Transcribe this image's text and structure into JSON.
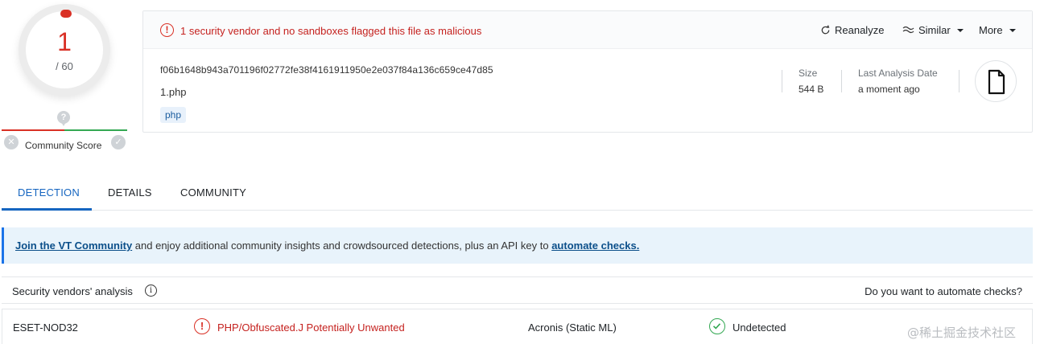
{
  "score": {
    "detections": "1",
    "total": "/ 60"
  },
  "community": {
    "label": "Community Score",
    "pin_glyph": "?"
  },
  "summary": {
    "alert": "1 security vendor and no sandboxes flagged this file as malicious",
    "actions": {
      "reanalyze": "Reanalyze",
      "similar": "Similar",
      "more": "More"
    },
    "hash": "f06b1648b943a701196f02772fe38f4161911950e2e037f84a136c659ce47d85",
    "filename": "1.php",
    "tag": "php",
    "size_label": "Size",
    "size_value": "544 B",
    "date_label": "Last Analysis Date",
    "date_value": "a moment ago"
  },
  "tabs": {
    "detection": "DETECTION",
    "details": "DETAILS",
    "community": "COMMUNITY",
    "active": "DETECTION"
  },
  "banner": {
    "link1": "Join the VT Community",
    "text": " and enjoy additional community insights and crowdsourced detections, plus an API key to ",
    "link2": "automate checks."
  },
  "vendors": {
    "title": "Security vendors' analysis",
    "automate_prompt": "Do you want to automate checks?",
    "rows": [
      {
        "vendor1": "ESET-NOD32",
        "result1": "PHP/Obfuscated.J Potentially Unwanted",
        "vendor2": "Acronis (Static ML)",
        "result2": "Undetected"
      }
    ]
  },
  "watermark": "@稀土掘金技术社区",
  "colors": {
    "malicious": "#d93025",
    "accent": "#1565c0",
    "clean": "#34a853"
  },
  "icons": [
    "alert-circle-icon",
    "refresh-icon",
    "similar-icon",
    "file-icon",
    "info-icon",
    "check-circle-icon",
    "close-icon"
  ]
}
